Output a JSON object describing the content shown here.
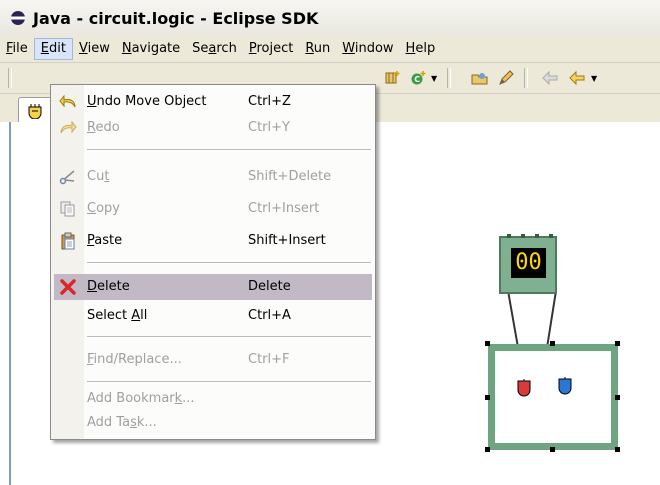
{
  "window": {
    "title": "Java - circuit.logic - Eclipse SDK"
  },
  "menubar": {
    "items": [
      {
        "name": "file",
        "label": "File",
        "mnemonic": "F",
        "rest": "ile"
      },
      {
        "name": "edit",
        "label": "Edit",
        "mnemonic": "E",
        "rest": "dit"
      },
      {
        "name": "view",
        "label": "View",
        "mnemonic": "V",
        "rest": "iew"
      },
      {
        "name": "navigate",
        "label": "Navigate",
        "mnemonic": "N",
        "rest": "avigate"
      },
      {
        "name": "search",
        "label": "Search",
        "pre": "Se",
        "mnemonic": "a",
        "rest": "rch"
      },
      {
        "name": "project",
        "label": "Project",
        "mnemonic": "P",
        "rest": "roject"
      },
      {
        "name": "run",
        "label": "Run",
        "mnemonic": "R",
        "rest": "un"
      },
      {
        "name": "window",
        "label": "Window",
        "mnemonic": "W",
        "rest": "indow"
      },
      {
        "name": "help",
        "label": "Help",
        "mnemonic": "H",
        "rest": "elp"
      }
    ]
  },
  "edit_menu": {
    "undo": {
      "pre": "",
      "mnemonic": "U",
      "rest": "ndo Move Object",
      "accel": "Ctrl+Z",
      "icon": "undo-icon"
    },
    "redo": {
      "pre": "",
      "mnemonic": "R",
      "rest": "edo",
      "accel": "Ctrl+Y",
      "icon": "redo-icon"
    },
    "cut": {
      "pre": "Cu",
      "mnemonic": "t",
      "rest": "",
      "accel": "Shift+Delete",
      "icon": "cut-icon"
    },
    "copy": {
      "pre": "",
      "mnemonic": "C",
      "rest": "opy",
      "accel": "Ctrl+Insert",
      "icon": "copy-icon"
    },
    "paste": {
      "pre": "",
      "mnemonic": "P",
      "rest": "aste",
      "accel": "Shift+Insert",
      "icon": "paste-icon"
    },
    "delete": {
      "pre": "",
      "mnemonic": "D",
      "rest": "elete",
      "accel": "Delete",
      "icon": "delete-icon"
    },
    "select_all": {
      "pre": "Select ",
      "mnemonic": "A",
      "rest": "ll",
      "accel": "Ctrl+A"
    },
    "find_replace": {
      "pre": "",
      "mnemonic": "F",
      "rest": "ind/Replace...",
      "accel": "Ctrl+F"
    },
    "add_bookmark": {
      "pre": "Add Bookmar",
      "mnemonic": "k",
      "rest": "..."
    },
    "add_task": {
      "pre": "Add Ta",
      "mnemonic": "s",
      "rest": "k..."
    }
  },
  "canvas": {
    "display_value": "00",
    "led_colors": {
      "left": "#d93a3a",
      "right": "#2a78d6"
    }
  },
  "colors": {
    "chip_fill": "#7fb08f",
    "highlight": "#c1b9c4",
    "disabled_text": "#a0a0a0"
  }
}
